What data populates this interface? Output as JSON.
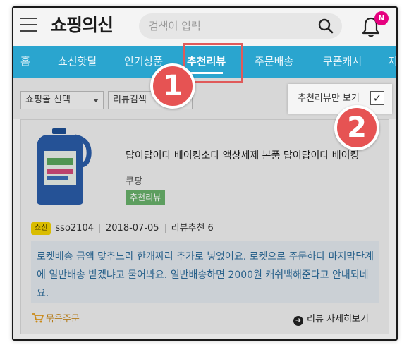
{
  "header": {
    "logo": "쇼핑의신",
    "search_placeholder": "검색어 입력",
    "notification_badge": "N"
  },
  "nav": {
    "tabs": [
      {
        "label": "홈",
        "active": false
      },
      {
        "label": "쇼신핫딜",
        "active": false
      },
      {
        "label": "인기상품",
        "active": false
      },
      {
        "label": "추천리뷰",
        "active": true
      },
      {
        "label": "주문배송",
        "active": false
      },
      {
        "label": "쿠폰캐시",
        "active": false
      },
      {
        "label": "지",
        "active": false
      }
    ]
  },
  "filters": {
    "mall_select": "쇼핑몰 선택",
    "review_select": "리뷰검색",
    "recommended_only_label": "추천리뷰만 보기",
    "recommended_only_checked": "✓"
  },
  "markers": {
    "first": "1",
    "second": "2"
  },
  "review": {
    "product_title": "답이답이다 베이킹소다 액상세제 본품 답이답이다 베이킹",
    "mall": "쿠팡",
    "tag": "추천리뷰",
    "user_badge": "쇼신",
    "username": "sso2104",
    "date": "2018-07-05",
    "recommend_count": "리뷰추천 6",
    "body": "로켓배송 금액 맞추느라 한개짜리 추가로 넣었어요. 로켓으로 주문하다 마지막단계에 일반배송 받겠냐고 물어봐요. 일반배송하면 2000원 캐쉬백해준다고 안내되네요.",
    "bundle_order": "묶음주문",
    "view_detail": "리뷰 자세히보기"
  },
  "colors": {
    "nav_bg": "#2aa5cf",
    "highlight": "#e05a5a",
    "marker": "#e65353",
    "tag_green": "#68b06a",
    "review_text": "#2c6b9a",
    "badge_pink": "#e5007e"
  }
}
